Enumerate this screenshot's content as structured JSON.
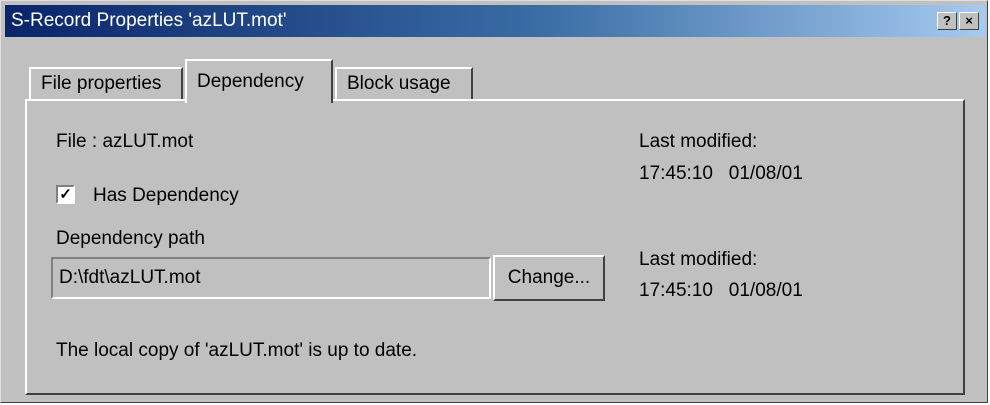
{
  "window": {
    "title": "S-Record Properties 'azLUT.mot'",
    "help_button": "?",
    "close_button": "×"
  },
  "tabs": [
    {
      "label": "File properties",
      "active": false
    },
    {
      "label": "Dependency",
      "active": true
    },
    {
      "label": "Block usage",
      "active": false
    }
  ],
  "dependency": {
    "file_label": "File : azLUT.mot",
    "last_modified_label_1": "Last modified:",
    "last_modified_value_1": "17:45:10   01/08/01",
    "has_dependency_label": "Has Dependency",
    "has_dependency_checked": true,
    "checkbox_mark": "✓",
    "path_label": "Dependency path",
    "path_value": "D:\\fdt\\azLUT.mot",
    "change_button": "Change...",
    "last_modified_label_2": "Last modified:",
    "last_modified_value_2": "17:45:10   01/08/01",
    "status_message": "The local copy of 'azLUT.mot' is up to date."
  }
}
